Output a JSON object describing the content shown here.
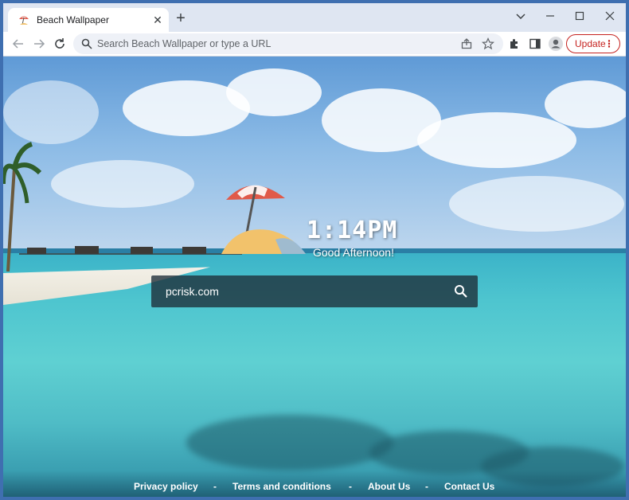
{
  "browser": {
    "tab_title": "Beach Wallpaper",
    "omnibox_placeholder": "Search Beach Wallpaper or type a URL",
    "update_label": "Update",
    "icons": {
      "tab_close": "close-icon",
      "new_tab": "plus-icon",
      "minimize": "minimize-icon",
      "maximize": "maximize-icon",
      "close_window": "close-icon",
      "tab_search": "chevron-down-icon",
      "back": "back-arrow-icon",
      "forward": "forward-arrow-icon",
      "reload": "reload-icon",
      "share": "share-icon",
      "bookmark": "star-icon",
      "extensions": "puzzle-icon",
      "side_panel": "side-panel-icon",
      "profile": "profile-icon",
      "menu": "kebab-menu-icon"
    },
    "accent_color": "#c5221f"
  },
  "page": {
    "time": "1:14PM",
    "greeting": "Good Afternoon!",
    "search_value": "pcrisk.com",
    "footer_links": [
      {
        "label": "Privacy policy"
      },
      {
        "label": "Terms and conditions"
      },
      {
        "label": "About Us"
      },
      {
        "label": "Contact Us"
      }
    ],
    "footer_separator": "-"
  }
}
